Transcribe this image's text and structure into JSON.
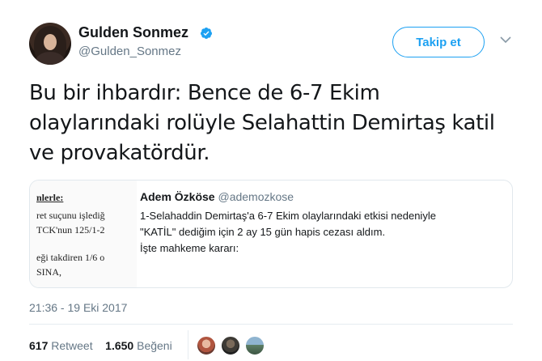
{
  "author": {
    "display_name": "Gulden Sonmez",
    "handle": "@Gulden_Sonmez",
    "verified": true,
    "avatar_icon": "user-avatar-icon"
  },
  "follow_button_label": "Takip et",
  "tweet_text": "Bu bir ihbardır: Bence de 6-7 Ekim olaylarındaki rolüyle Selahattin Demirtaş katil ve provakatördür.",
  "quoted_tweet": {
    "author_name": "Adem Özköse",
    "author_handle": "@ademozkose",
    "text_line1": "1-Selahaddin Demirtaş'a 6-7 Ekim olaylarındaki etkisi nedeniyle",
    "text_line2": "\"KATİL\" dediğim için 2 ay 15 gün hapis cezası aldım.",
    "text_line3": "İşte mahkeme kararı:",
    "image_lines": [
      "nlerle:",
      "ret suçunu işlediğ",
      "TCK'nun 125/1-2",
      "eği takdiren 1/6 o",
      "SINA,"
    ]
  },
  "timestamp": "21:36 - 19 Eki 2017",
  "stats": {
    "retweet_count": "617",
    "retweet_label": "Retweet",
    "like_count": "1.650",
    "like_label": "Beğeni"
  },
  "colors": {
    "accent": "#1da1f2",
    "text": "#14171a",
    "secondary": "#657786",
    "border": "#e1e8ed"
  }
}
